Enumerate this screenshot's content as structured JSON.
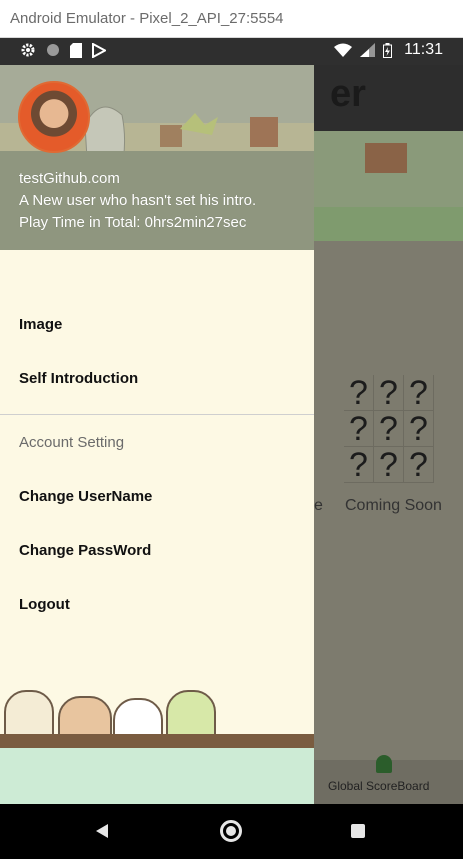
{
  "window": {
    "title": "Android Emulator - Pixel_2_API_27:5554"
  },
  "status_bar": {
    "left_icons": [
      "gear-icon",
      "circle-icon",
      "sd-card-icon",
      "play-store-icon"
    ],
    "right_icons": [
      "wifi-icon",
      "signal-icon",
      "battery-icon"
    ],
    "time": "11:31"
  },
  "drawer": {
    "header": {
      "email": "testGithub.com",
      "intro": "A New user who hasn't set his intro.",
      "play_time": "Play Time in Total: 0hrs2min27sec"
    },
    "items": [
      {
        "label": "Image"
      },
      {
        "label": "Self Introduction"
      }
    ],
    "section_title": "Account Setting",
    "account_items": [
      {
        "label": "Change UserName"
      },
      {
        "label": "Change PassWord"
      },
      {
        "label": "Logout"
      }
    ]
  },
  "background_app": {
    "toolbar_title_partial": "er",
    "coming_soon_grid": [
      "?",
      "?",
      "?",
      "?",
      "?",
      "?",
      "?",
      "?",
      "?"
    ],
    "coming_soon_label": "Coming Soon",
    "left_partial_label": "e",
    "bottom_nav_label": "Global ScoreBoard"
  },
  "colors": {
    "drawer_bg": "#fdf9e4",
    "status_bar": "#2f2f2f",
    "scrim": "#7d7b6e",
    "avatar_ring": "#e06a34"
  }
}
